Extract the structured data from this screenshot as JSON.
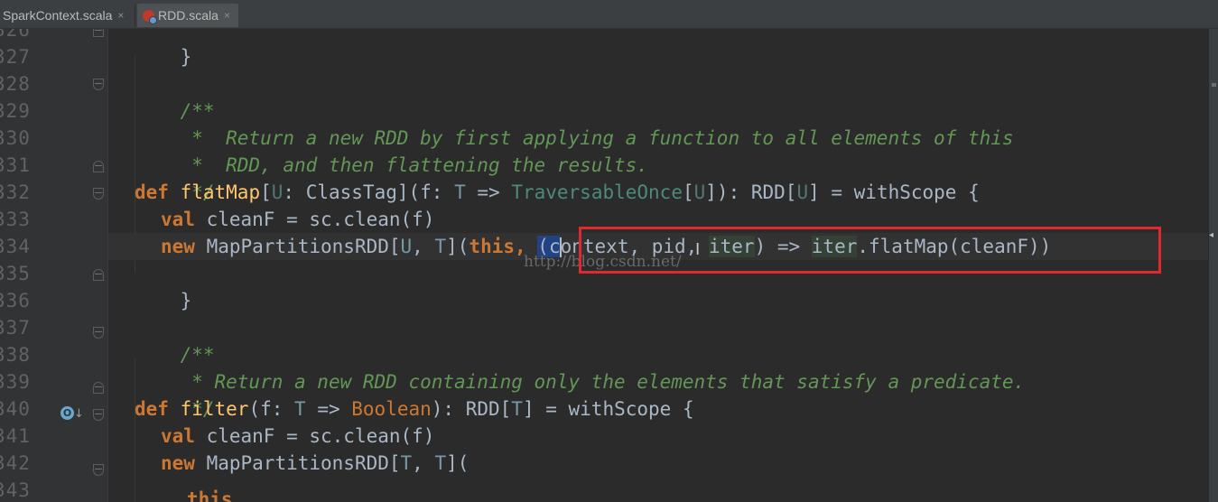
{
  "tabs": [
    {
      "label": "SparkContext.scala",
      "close": "×",
      "icon": "scala-file-icon",
      "active": false
    },
    {
      "label": "RDD.scala",
      "close": "×",
      "icon": "scala-file-icon",
      "active": true
    }
  ],
  "gutter": {
    "line_numbers": [
      "326",
      "327",
      "328",
      "329",
      "330",
      "331",
      "332",
      "333",
      "334",
      "335",
      "336",
      "337",
      "338",
      "339",
      "340",
      "341",
      "342",
      "343"
    ],
    "override_icon": "O"
  },
  "code": {
    "l326": "}",
    "l328_open": "/**",
    "l329": " *  Return a new RDD by first applying a function to all elements of this",
    "l330": " *  RDD, and then flattening the results.",
    "l331": " */",
    "l332": {
      "def": "def",
      "name": "flatMap",
      "open": "[",
      "tparam": "U",
      "colon": ": ClassTag](f: ",
      "t": "T",
      "arrow": " => ",
      "trav": "TraversableOnce",
      "lb": "[",
      "u2": "U",
      "rest": "]): RDD[",
      "u3": "U",
      "end": "] = withScope {"
    },
    "l333": {
      "kw": "val",
      "rest": " cleanF = sc.clean(f)"
    },
    "l334": {
      "kw": "new",
      "a": " MapPartitionsRDD[",
      "u": "U",
      "comma": ", ",
      "t": "T",
      "b": "](",
      "this": "this",
      "c": ", ",
      "paren": "(",
      "ch": "c",
      "ontext": "ontext",
      "d": ", pid, ",
      "iter1": "iter",
      "e": ") => ",
      "iter2": "iter",
      "f": ".flatMap(cleanF)",
      "g": ")"
    },
    "l335": "}",
    "l337_open": "/**",
    "l338": " * Return a new RDD containing only the elements that satisfy a predicate.",
    "l339": " */",
    "l340": {
      "def": "def",
      "name": "filter",
      "a": "(f: ",
      "t": "T",
      "arrow": " => ",
      "bool": "Boolean",
      "b": "): RDD[",
      "t2": "T",
      "end": "] = withScope {"
    },
    "l341": {
      "kw": "val",
      "rest": " cleanF = sc.clean(f)"
    },
    "l342": {
      "kw": "new",
      "a": " MapPartitionsRDD[",
      "t": "T",
      "comma": ", ",
      "t2": "T",
      "b": "]("
    },
    "l343": {
      "kw": "this"
    }
  },
  "watermark": "http://blog.csdn.net/",
  "colors": {
    "background": "#2b2b2b",
    "comment": "#629755",
    "keyword": "#cc7832",
    "text": "#a9b7c6",
    "type_param": "#507874",
    "function_decl": "#ffc66d",
    "annotation_box": "#e0292e"
  }
}
